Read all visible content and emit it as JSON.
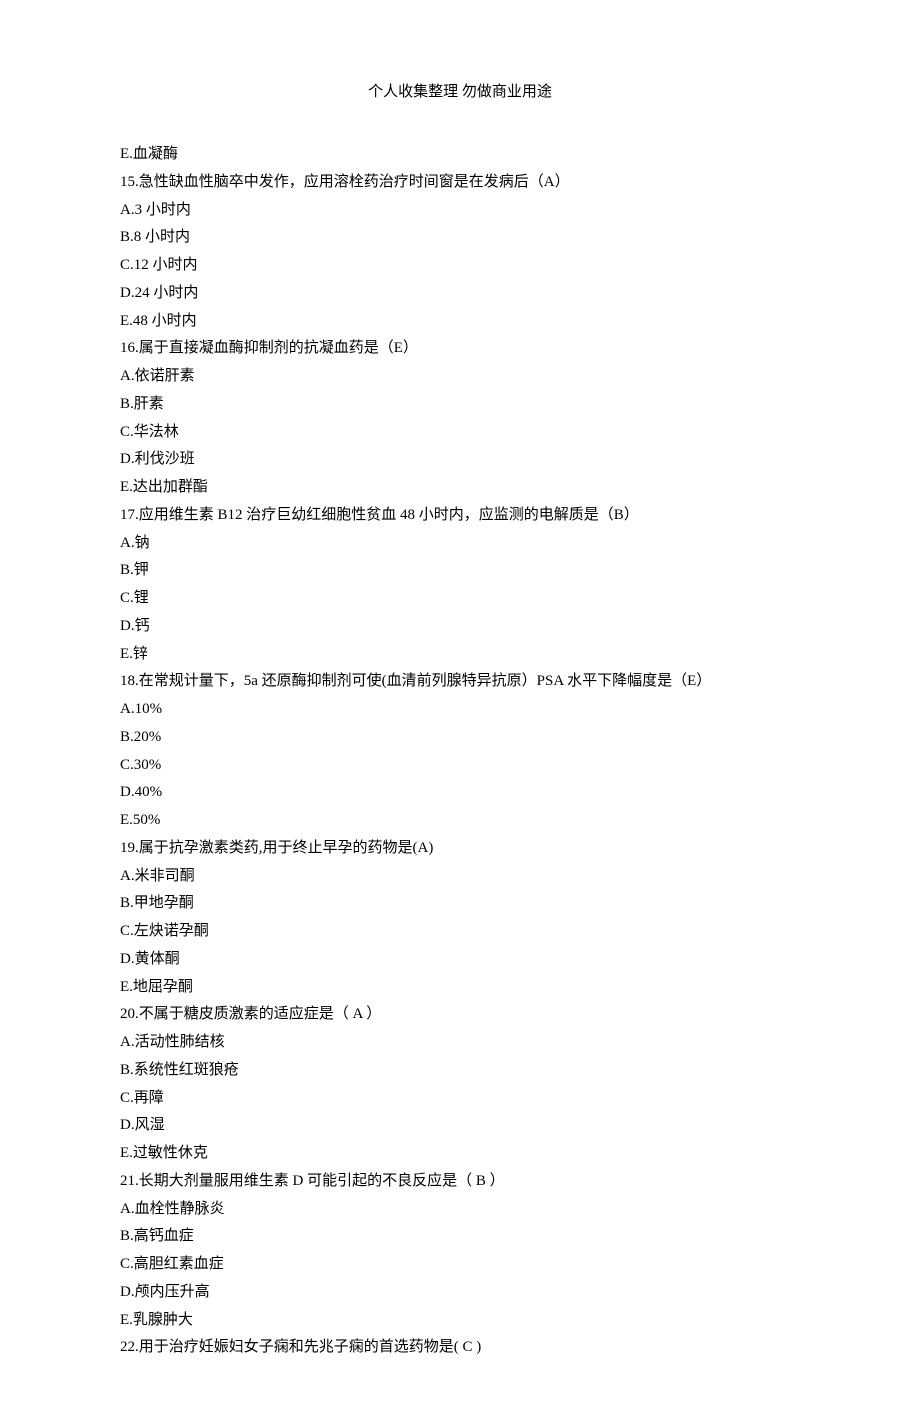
{
  "header": "个人收集整理  勿做商业用途",
  "lines": [
    "E.血凝酶",
    "15.急性缺血性脑卒中发作，应用溶栓药治疗时间窗是在发病后（A）",
    "A.3 小时内",
    "B.8 小时内",
    "C.12 小时内",
    "D.24 小时内",
    "E.48 小时内",
    "16.属于直接凝血酶抑制剂的抗凝血药是（E）",
    "A.依诺肝素",
    "B.肝素",
    "C.华法林",
    "D.利伐沙班",
    "E.达出加群酯",
    "17.应用维生素 B12 治疗巨幼红细胞性贫血 48 小时内，应监测的电解质是（B）",
    "A.钠",
    "B.钾",
    "C.锂",
    "D.钙",
    "E.锌",
    "18.在常规计量下，5a 还原酶抑制剂可使(血清前列腺特异抗原）PSA 水平下降幅度是（E）",
    "A.10%",
    "B.20%",
    "C.30%",
    "D.40%",
    "E.50%",
    "19.属于抗孕激素类药,用于终止早孕的药物是(A)",
    "A.米非司酮",
    "B.甲地孕酮",
    "C.左炔诺孕酮",
    "D.黄体酮",
    "E.地屈孕酮",
    "20.不属于糖皮质激素的适应症是（ A ）",
    "A.活动性肺结核",
    "B.系统性红斑狼疮",
    "C.再障",
    "D.风湿",
    "E.过敏性休克",
    "21.长期大剂量服用维生素 D 可能引起的不良反应是（ B ）",
    "A.血栓性静脉炎",
    "B.高钙血症",
    "C.高胆红素血症",
    "D.颅内压升高",
    "E.乳腺肿大",
    "22.用于治疗妊娠妇女子痫和先兆子痫的首选药物是( C )"
  ]
}
